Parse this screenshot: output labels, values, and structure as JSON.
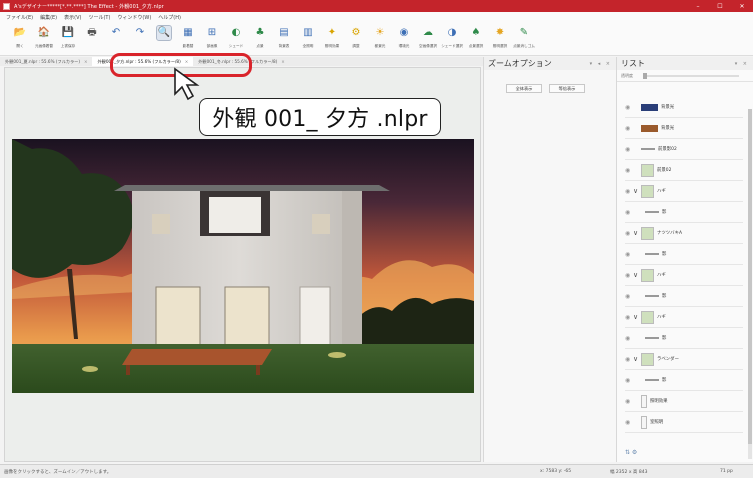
{
  "window": {
    "title": "A'sデザイナー*****[*.**.****] The Effect - 外観001_夕方.nlpr",
    "controls": [
      "–",
      "☐",
      "✕"
    ]
  },
  "menu": [
    "ファイル(E)",
    "編集(E)",
    "表示(V)",
    "ツール(T)",
    "ウィンドウ(W)",
    "ヘルプ(H)"
  ],
  "toolbar": [
    {
      "label": "開く",
      "icon": "folder-open-icon",
      "glyph": "📂",
      "color": "#e5a623"
    },
    {
      "label": "元画像着替",
      "icon": "picture-swap-icon",
      "glyph": "🏠",
      "color": "#e0a060"
    },
    {
      "label": "上書保存",
      "icon": "save-icon",
      "glyph": "💾",
      "color": "#3d6fb5"
    },
    {
      "label": "",
      "icon": "print-icon",
      "glyph": "🖶",
      "color": "#555"
    },
    {
      "label": "",
      "icon": "undo-icon",
      "glyph": "↶",
      "color": "#3d6fb5"
    },
    {
      "label": "",
      "icon": "redo-icon",
      "glyph": "↷",
      "color": "#3d6fb5"
    },
    {
      "label": "",
      "icon": "zoom-icon",
      "glyph": "🔍",
      "color": "#555",
      "selected": true
    },
    {
      "label": "影着替",
      "icon": "shadow-icon",
      "glyph": "▦",
      "color": "#3d6fb5"
    },
    {
      "label": "部画像",
      "icon": "grid-image-icon",
      "glyph": "⊞",
      "color": "#3d6fb5"
    },
    {
      "label": "シェード",
      "icon": "shade-icon",
      "glyph": "◐",
      "color": "#2f8a4a"
    },
    {
      "label": "点景",
      "icon": "tree-icon",
      "glyph": "♣",
      "color": "#2f8a4a"
    },
    {
      "label": "背景表",
      "icon": "background-icon",
      "glyph": "▤",
      "color": "#3d6fb5"
    },
    {
      "label": "全照明",
      "icon": "light-icon",
      "glyph": "▥",
      "color": "#3d6fb5"
    },
    {
      "label": "照明効果",
      "icon": "light-effect-icon",
      "glyph": "✦",
      "color": "#d9a400"
    },
    {
      "label": "調整",
      "icon": "adjust-icon",
      "glyph": "⚙",
      "color": "#d9a400"
    },
    {
      "label": "都景光",
      "icon": "sunlight-icon",
      "glyph": "☀",
      "color": "#e5a623"
    },
    {
      "label": "環境光",
      "icon": "ambient-icon",
      "glyph": "◉",
      "color": "#3d6fb5"
    },
    {
      "label": "空画像選択",
      "icon": "sky-select-icon",
      "glyph": "☁",
      "color": "#2f8a4a"
    },
    {
      "label": "シェード選択",
      "icon": "shade-select-icon",
      "glyph": "◑",
      "color": "#3d6fb5"
    },
    {
      "label": "点景選択",
      "icon": "tree-select-icon",
      "glyph": "♠",
      "color": "#2f8a4a"
    },
    {
      "label": "照明選択",
      "icon": "light-select-icon",
      "glyph": "✸",
      "color": "#e5a623"
    },
    {
      "label": "点景消しゴム",
      "icon": "eraser-icon",
      "glyph": "✎",
      "color": "#2f8a4a"
    }
  ],
  "tabs": [
    {
      "label": "外観001_夏.nlpr : 55.6% (フルカラー)",
      "active": false
    },
    {
      "label": "外観001_夕方.nlpr : 55.6% (フルカラー/8)",
      "active": true
    },
    {
      "label": "外観001_冬.nlpr : 55.6% (フルカラー/8)",
      "active": false
    }
  ],
  "callout": {
    "text": "外観 001_ 夕方 .nlpr"
  },
  "zoom_panel": {
    "title": "ズームオプション",
    "controls": "▾ ◂ ×",
    "buttons": [
      "全体表示",
      "等倍表示"
    ]
  },
  "list_panel": {
    "title": "リスト",
    "controls": "▾ ×",
    "opacity_label": "透明度",
    "layers": [
      {
        "label": "背景光",
        "kind": "swatch",
        "color": "#2a3e78",
        "expand": false
      },
      {
        "label": "背景光",
        "kind": "swatch",
        "color": "#9a5a2c",
        "expand": false
      },
      {
        "label": "前景影02",
        "kind": "line",
        "expand": false
      },
      {
        "label": "前景02",
        "kind": "thumb",
        "expand": false
      },
      {
        "label": "ハギ",
        "kind": "thumb",
        "expand": true
      },
      {
        "label": "影",
        "kind": "line",
        "expand": false,
        "indent": true
      },
      {
        "label": "ナツツバキA",
        "kind": "thumb",
        "expand": true
      },
      {
        "label": "影",
        "kind": "line",
        "expand": false,
        "indent": true
      },
      {
        "label": "ハギ",
        "kind": "thumb",
        "expand": true
      },
      {
        "label": "影",
        "kind": "line",
        "expand": false,
        "indent": true
      },
      {
        "label": "ハギ",
        "kind": "thumb",
        "expand": true
      },
      {
        "label": "影",
        "kind": "line",
        "expand": false,
        "indent": true
      },
      {
        "label": "ラベンダー",
        "kind": "thumb",
        "expand": true
      },
      {
        "label": "影",
        "kind": "line",
        "expand": false,
        "indent": true
      },
      {
        "label": "照明効果",
        "kind": "frame",
        "expand": false
      },
      {
        "label": "室照明",
        "kind": "frame",
        "expand": false
      }
    ],
    "bottom_icons": "⇅ ⚙"
  },
  "status": {
    "hint": "画像をクリックすると、ズームイン／アウトします。",
    "coords": "x: 7583  y: -65",
    "size": "幅 2352 x 高 843",
    "px": "71 pp"
  },
  "colors": {
    "accent": "#c4242b",
    "highlight": "#d9242b"
  }
}
